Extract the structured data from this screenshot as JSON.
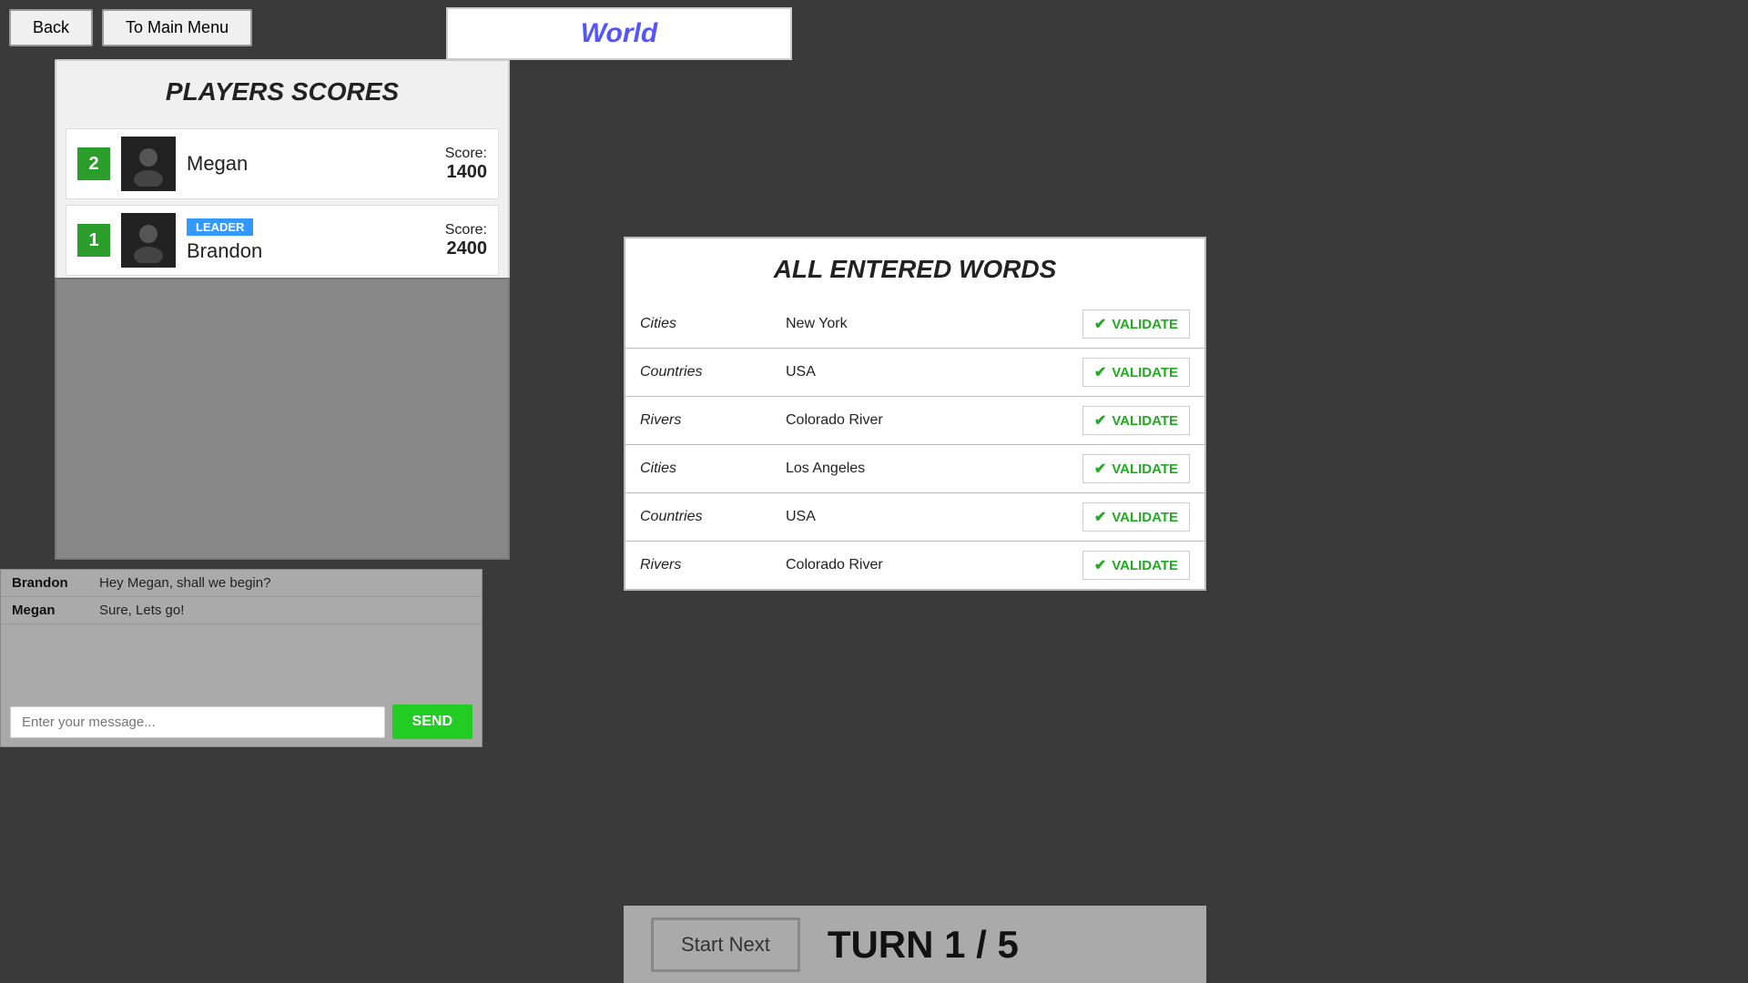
{
  "nav": {
    "back_label": "Back",
    "main_menu_label": "To Main Menu"
  },
  "world_title": "World",
  "players_panel": {
    "title": "PLAYERS SCORES",
    "players": [
      {
        "rank": "2",
        "name": "Megan",
        "score_label": "Score:",
        "score_value": "1400",
        "is_leader": false
      },
      {
        "rank": "1",
        "name": "Brandon",
        "score_label": "Score:",
        "score_value": "2400",
        "is_leader": true,
        "leader_label": "LEADER"
      }
    ]
  },
  "words_panel": {
    "title": "ALL ENTERED WORDS",
    "entries": [
      {
        "category": "Cities",
        "word": "New York",
        "validate_label": "VALIDATE"
      },
      {
        "category": "Countries",
        "word": "USA",
        "validate_label": "VALIDATE"
      },
      {
        "category": "Rivers",
        "word": "Colorado River",
        "validate_label": "VALIDATE"
      },
      {
        "category": "Cities",
        "word": "Los Angeles",
        "validate_label": "VALIDATE"
      },
      {
        "category": "Countries",
        "word": "USA",
        "validate_label": "VALIDATE"
      },
      {
        "category": "Rivers",
        "word": "Colorado River",
        "validate_label": "VALIDATE"
      }
    ]
  },
  "chat": {
    "messages": [
      {
        "sender": "Brandon",
        "text": "Hey Megan, shall we begin?"
      },
      {
        "sender": "Megan",
        "text": "Sure, Lets go!"
      }
    ],
    "input_placeholder": "Enter your message...",
    "send_label": "SEND"
  },
  "bottom_bar": {
    "start_next_label": "Start Next",
    "turn_text": "TURN 1 / 5"
  }
}
